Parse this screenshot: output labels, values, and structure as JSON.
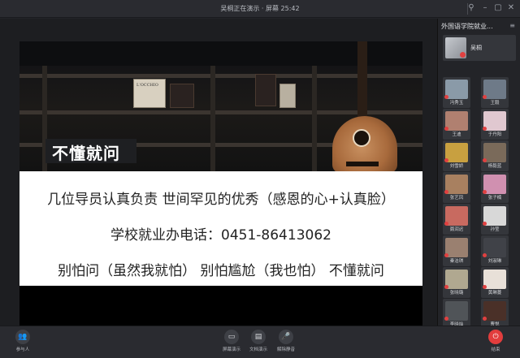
{
  "window": {
    "title": "吴桐正在演示 · 屏幕 25:42"
  },
  "slide": {
    "banner_label": "不懂就问",
    "book_title": "L'OCCHIO",
    "line1": "几位导员认真负责 世间罕见的优秀（感恩的心+认真脸）",
    "line2": "学校就业办电话：0451-86413062",
    "line3": "别怕问（虽然我就怕） 别怕尴尬（我也怕） 不懂就问"
  },
  "panel": {
    "title": "外国语学院就业...",
    "self_name": "吴桐",
    "participants": [
      {
        "name": "冯秀玉",
        "color": "#8a9aa8"
      },
      {
        "name": "王毅",
        "color": "#6e7a88"
      },
      {
        "name": "王迪",
        "color": "#b08070"
      },
      {
        "name": "于丹阳",
        "color": "#e0c8d0"
      },
      {
        "name": "刘雪娇",
        "color": "#c8a040"
      },
      {
        "name": "杨毅蓝",
        "color": "#7a6a5a"
      },
      {
        "name": "张艺凤",
        "color": "#a88060"
      },
      {
        "name": "张子楠",
        "color": "#d090b0"
      },
      {
        "name": "聂润迟",
        "color": "#c86a60"
      },
      {
        "name": "孙莹",
        "color": "#d8d8d8"
      },
      {
        "name": "秦洁琪",
        "color": "#9a8070"
      },
      {
        "name": "刘淑琳",
        "color": "#404248"
      },
      {
        "name": "张晓璐",
        "color": "#b0a890"
      },
      {
        "name": "黄琳蔓",
        "color": "#e8e0d8"
      },
      {
        "name": "李晓灿",
        "color": "#505458"
      },
      {
        "name": "曹悦",
        "color": "#4a3028"
      }
    ]
  },
  "bottom": {
    "participants_label": "参与人",
    "screen_share_label": "屏幕演示",
    "doc_share_label": "文档演示",
    "mute_all_label": "解除静音",
    "end_label": "结束"
  }
}
